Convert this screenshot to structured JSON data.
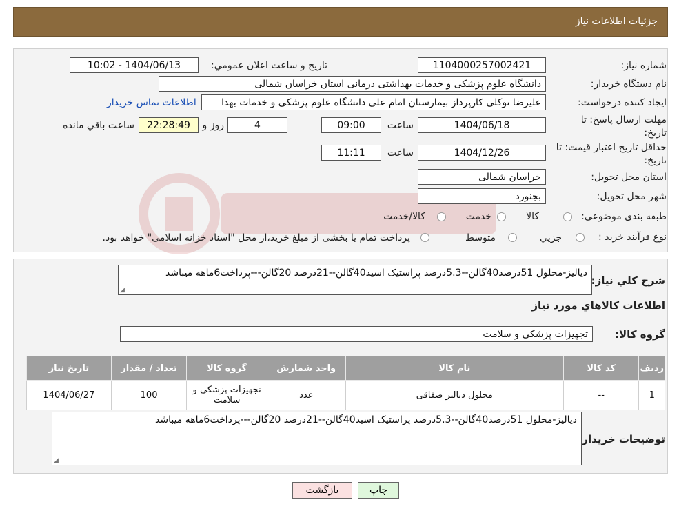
{
  "header": {
    "title": "جزئیات اطلاعات نیاز"
  },
  "need": {
    "number_label": "شماره نیاز:",
    "number_value": "1104000257002421",
    "announce_label": "تاریخ و ساعت اعلان عمومي:",
    "announce_value": "1404/06/13 - 10:02",
    "buyer_label": "نام دستگاه خریدار:",
    "buyer_value": "دانشگاه علوم پزشکی و خدمات بهداشتی درمانی استان خراسان شمالی",
    "creator_label": "ایجاد کننده درخواست:",
    "creator_value": "علیرضا توکلی کارپرداز بیمارستان امام علی دانشگاه علوم پزشکی و خدمات بهدا",
    "contact_link": "اطلاعات تماس خریدار",
    "deadline_label_1": "مهلت ارسال پاسخ: تا",
    "deadline_label_2": "تاریخ:",
    "deadline_date": "1404/06/18",
    "time_label": "ساعت",
    "deadline_time": "09:00",
    "days_value": "4",
    "days_label": "روز و",
    "remaining_value": "22:28:49",
    "remaining_label": "ساعت باقي مانده",
    "validity_label_1": "حداقل تاریخ اعتبار قیمت: تا",
    "validity_label_2": "تاریخ:",
    "validity_date": "1404/12/26",
    "validity_time": "11:11",
    "province_label": "استان محل تحویل:",
    "province_value": "خراسان شمالی",
    "city_label": "شهر محل تحویل:",
    "city_value": "بجنورد",
    "category_label": "طبقه بندی موضوعی:",
    "category_options": [
      "کالا",
      "خدمت",
      "کالا/خدمت"
    ],
    "process_label": "نوع فرآیند خرید :",
    "process_options": [
      "جزیي",
      "متوسط"
    ],
    "process_note": "پرداخت تمام یا بخشی از مبلغ خرید،از محل \"اسناد خزانه اسلامی\" خواهد بود."
  },
  "summary": {
    "label": "شرح كلي نياز:",
    "value": "دیالیز-محلول 51درصد40گالن--5.3درصد پراستیک اسید40گالن--21درصد 20گالن---پرداخت6ماهه میباشد"
  },
  "goods": {
    "section_title": "اطلاعات كالاهاي مورد نياز",
    "group_label": "گروه کالا:",
    "group_value": "تجهیزات پزشکی و سلامت",
    "columns": {
      "row": "رديف",
      "code": "کد کالا",
      "name": "نام کالا",
      "unit": "واحد شمارش",
      "group": "گروه کالا",
      "qty": "تعداد / مقدار",
      "date": "تاریخ نیاز"
    },
    "rows": [
      {
        "row": "1",
        "code": "--",
        "name": "محلول دیالیز صفاقی",
        "unit": "عدد",
        "group": "تجهیزات پزشکی و سلامت",
        "qty": "100",
        "date": "1404/06/27"
      }
    ]
  },
  "buyer_notes": {
    "label": "توضیحات خریدار:",
    "value": "دیالیز-محلول 51درصد40گالن--5.3درصد پراستیک اسید40گالن--21درصد 20گالن---پرداخت6ماهه میباشد"
  },
  "buttons": {
    "print": "چاپ",
    "back": "بازگشت"
  },
  "colors": {
    "header_bg": "#8b6a3d",
    "table_header_bg": "#9f9f9f",
    "remaining_bg": "#ffffcc",
    "link": "#1a4fb5",
    "print_bg": "#dff7dc",
    "back_bg": "#fbe1e1"
  }
}
